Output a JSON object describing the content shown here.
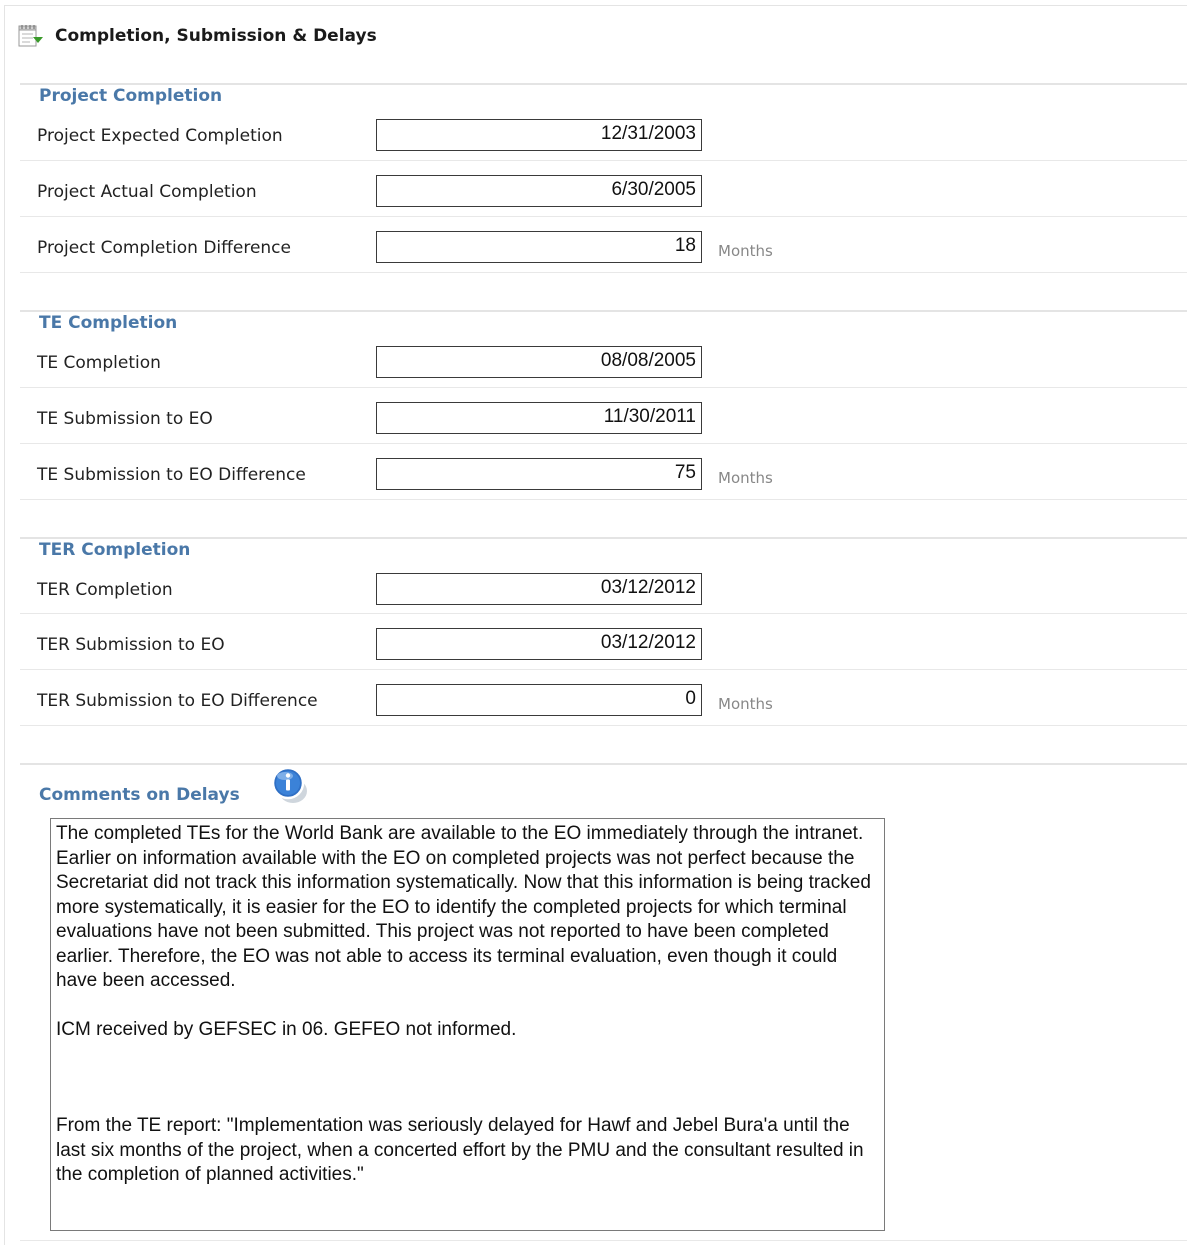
{
  "header": {
    "title": "Completion, Submission & Delays",
    "icon": "notepad-check-icon"
  },
  "sections": [
    {
      "title": "Project Completion",
      "rows": [
        {
          "label": "Project Expected Completion",
          "value": "12/31/2003",
          "unit": ""
        },
        {
          "label": "Project Actual Completion",
          "value": "6/30/2005",
          "unit": ""
        },
        {
          "label": "Project Completion Difference",
          "value": "18",
          "unit": "Months"
        }
      ]
    },
    {
      "title": "TE Completion",
      "rows": [
        {
          "label": "TE Completion",
          "value": "08/08/2005",
          "unit": ""
        },
        {
          "label": "TE Submission to EO",
          "value": "11/30/2011",
          "unit": ""
        },
        {
          "label": "TE Submission to EO Difference",
          "value": "75",
          "unit": "Months"
        }
      ]
    },
    {
      "title": "TER Completion",
      "rows": [
        {
          "label": "TER Completion",
          "value": "03/12/2012",
          "unit": ""
        },
        {
          "label": "TER Submission to EO",
          "value": "03/12/2012",
          "unit": ""
        },
        {
          "label": "TER Submission to EO Difference",
          "value": "0",
          "unit": "Months"
        }
      ]
    }
  ],
  "comments": {
    "title": "Comments on Delays",
    "icon": "info-icon",
    "paragraphs": [
      "The completed TEs for the World Bank are available to the EO immediately through the intranet. Earlier on information available with the EO on completed projects was not perfect because the Secretariat did not track this information systematically. Now that this information is being tracked more systematically, it is easier for the EO to identify the completed projects for which terminal evaluations have not been submitted. This project was not reported to have been completed earlier. Therefore, the EO was not able to access its terminal evaluation, even though it could have been accessed.",
      "ICM received by GEFSEC in 06. GEFEO not informed.",
      "From the TE report: \"Implementation was seriously delayed for Hawf and Jebel Bura'a until the last six months of the project, when a concerted effort by the PMU and the consultant resulted in the completion of planned activities.\""
    ]
  }
}
